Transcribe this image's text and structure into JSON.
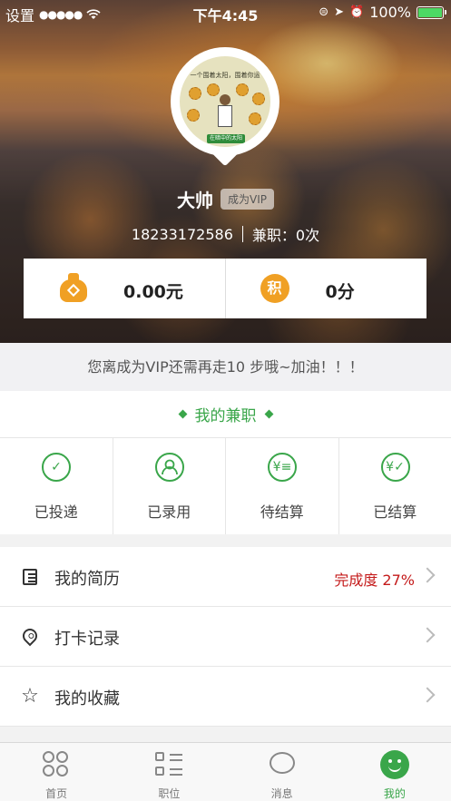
{
  "status_bar": {
    "back_app": "设置",
    "signal": "●●●●●",
    "time": "下午4:45",
    "battery_pct": "100%",
    "battery_level": 1.0
  },
  "profile": {
    "avatar_caption": "一个围着太阳，围着你运",
    "avatar_tag": "在暗中的太阳",
    "name": "大帅",
    "vip_button": "成为VIP",
    "phone": "18233172586",
    "parttime_count": "兼职：0次"
  },
  "balance": {
    "money": "0.00元",
    "points_icon": "积",
    "points": "0分"
  },
  "vip_tip": "您离成为VIP还需再走10 步哦~加油！！！",
  "parttime": {
    "title": "我的兼职",
    "items": [
      {
        "label": "已投递",
        "icon": "check-circle-icon",
        "glyph": "✓"
      },
      {
        "label": "已录用",
        "icon": "user-circle-icon",
        "glyph": "👤"
      },
      {
        "label": "待结算",
        "icon": "yen-list-icon",
        "glyph": "¥≡"
      },
      {
        "label": "已结算",
        "icon": "yen-check-icon",
        "glyph": "¥✓"
      }
    ]
  },
  "menu": {
    "resume": {
      "label": "我的简历",
      "extra": "完成度 27%"
    },
    "checkin": {
      "label": "打卡记录"
    },
    "favorites": {
      "label": "我的收藏",
      "glyph": "☆"
    }
  },
  "tabbar": {
    "home": "首页",
    "jobs": "职位",
    "messages": "消息",
    "mine": "我的"
  },
  "colors": {
    "accent": "#3aa64a",
    "coin": "#f0a024",
    "highlight": "#c41a1a"
  }
}
